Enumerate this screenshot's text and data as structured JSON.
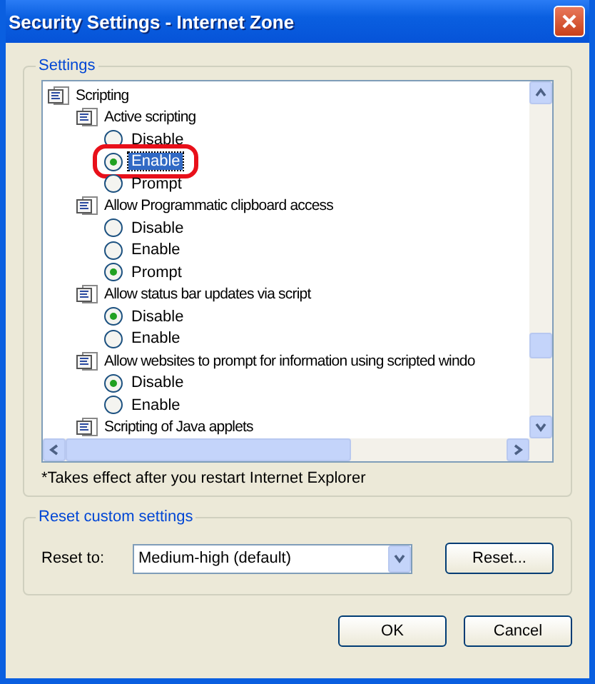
{
  "window": {
    "title": "Security Settings - Internet Zone"
  },
  "settings": {
    "legend": "Settings",
    "tree": [
      {
        "kind": "category",
        "label": "Scripting",
        "children": [
          {
            "kind": "setting",
            "label": "Active scripting",
            "children": [
              {
                "kind": "option",
                "label": "Disable",
                "selected": false,
                "focused": false,
                "circled": false
              },
              {
                "kind": "option",
                "label": "Enable",
                "selected": true,
                "focused": true,
                "circled": true
              },
              {
                "kind": "option",
                "label": "Prompt",
                "selected": false,
                "focused": false,
                "circled": false
              }
            ]
          },
          {
            "kind": "setting",
            "label": "Allow Programmatic clipboard access",
            "children": [
              {
                "kind": "option",
                "label": "Disable",
                "selected": false,
                "focused": false,
                "circled": false
              },
              {
                "kind": "option",
                "label": "Enable",
                "selected": false,
                "focused": false,
                "circled": false
              },
              {
                "kind": "option",
                "label": "Prompt",
                "selected": true,
                "focused": false,
                "circled": false
              }
            ]
          },
          {
            "kind": "setting",
            "label": "Allow status bar updates via script",
            "children": [
              {
                "kind": "option",
                "label": "Disable",
                "selected": true,
                "focused": false,
                "circled": false
              },
              {
                "kind": "option",
                "label": "Enable",
                "selected": false,
                "focused": false,
                "circled": false
              }
            ]
          },
          {
            "kind": "setting",
            "label": "Allow websites to prompt for information using scripted windo",
            "children": [
              {
                "kind": "option",
                "label": "Disable",
                "selected": true,
                "focused": false,
                "circled": false
              },
              {
                "kind": "option",
                "label": "Enable",
                "selected": false,
                "focused": false,
                "circled": false
              }
            ]
          },
          {
            "kind": "setting",
            "label": "Scripting of Java applets"
          }
        ]
      }
    ],
    "note": "*Takes effect after you restart Internet Explorer"
  },
  "reset": {
    "legend": "Reset custom settings",
    "label": "Reset to:",
    "value": "Medium-high (default)",
    "button": "Reset..."
  },
  "buttons": [
    "OK",
    "Cancel"
  ]
}
